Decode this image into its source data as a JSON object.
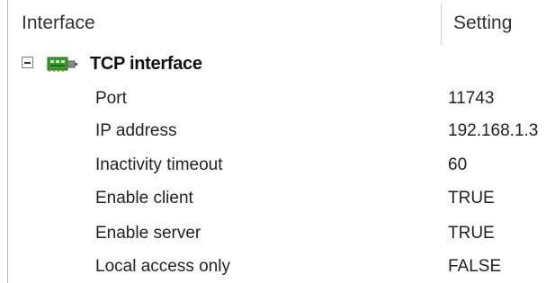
{
  "headers": {
    "interface": "Interface",
    "setting": "Setting"
  },
  "group": {
    "label": "TCP interface",
    "expanded": true,
    "icon": "tcp-network-card-icon",
    "icon_color": "#3a9a2a"
  },
  "properties": [
    {
      "name": "Port",
      "value": "11743"
    },
    {
      "name": "IP address",
      "value": "192.168.1.3"
    },
    {
      "name": "Inactivity timeout",
      "value": "60"
    },
    {
      "name": "Enable client",
      "value": "TRUE"
    },
    {
      "name": "Enable server",
      "value": "TRUE"
    },
    {
      "name": "Local access only",
      "value": "FALSE"
    }
  ]
}
